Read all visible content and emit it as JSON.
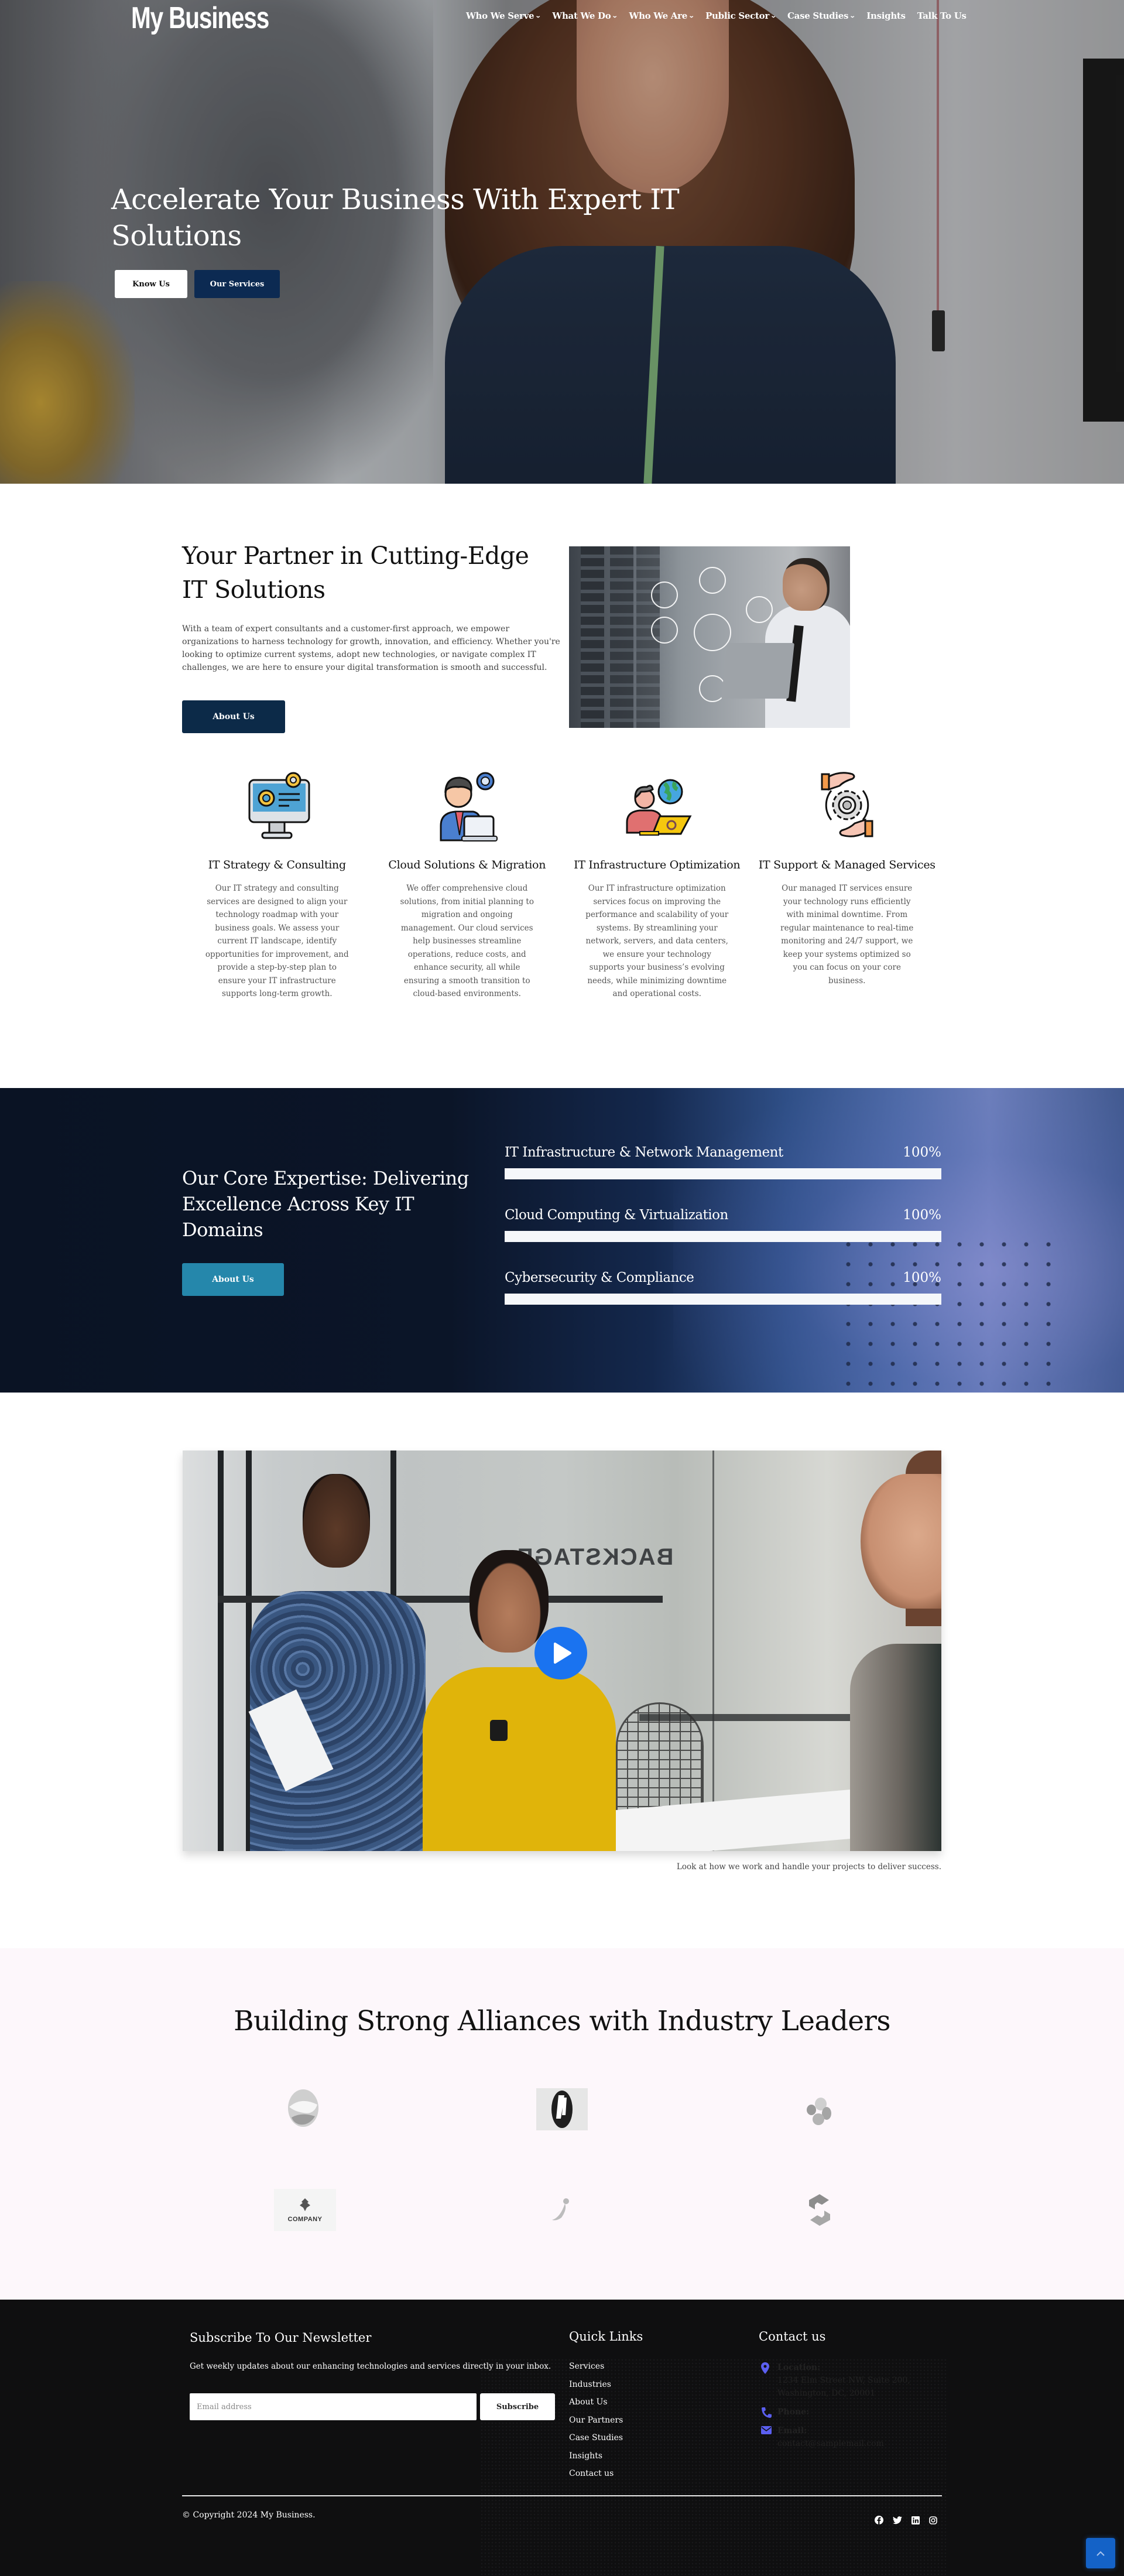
{
  "brand": {
    "name": "My Business"
  },
  "nav": {
    "items": [
      {
        "label": "Who We Serve",
        "dropdown": true
      },
      {
        "label": "What We Do",
        "dropdown": true
      },
      {
        "label": "Who We Are",
        "dropdown": true
      },
      {
        "label": "Public Sector",
        "dropdown": true
      },
      {
        "label": "Case Studies",
        "dropdown": true
      },
      {
        "label": "Insights",
        "dropdown": false
      },
      {
        "label": "Talk To Us",
        "dropdown": false
      }
    ],
    "chevron_icon": "chevron-down-icon"
  },
  "hero": {
    "title": "Accelerate Your Business With Expert IT Solutions",
    "primary_button": "Know Us",
    "secondary_button": "Our Services"
  },
  "about": {
    "title": "Your Partner in Cutting-Edge IT Solutions",
    "text": "With a team of expert consultants and a customer-first approach, we empower organizations to harness technology for growth, innovation, and efficiency. Whether you're looking to optimize current systems, adopt new technologies, or navigate complex IT challenges, we are here to ensure your digital transformation is smooth and successful.",
    "button": "About Us"
  },
  "services": [
    {
      "icon": "monitor-gear-icon",
      "title": "IT Strategy & Consulting",
      "text": "Our IT strategy and consulting services are designed to align your technology roadmap with your business goals. We assess your current IT landscape, identify opportunities for improvement, and provide a step-by-step plan to ensure your IT infrastructure supports long-term growth."
    },
    {
      "icon": "consultant-laptop-icon",
      "title": "Cloud Solutions & Migration",
      "text": "We offer comprehensive cloud solutions, from initial planning to migration and ongoing management. Our cloud services help businesses streamline operations, reduce costs, and enhance security, all while ensuring a smooth transition to cloud-based environments."
    },
    {
      "icon": "user-globe-laptop-icon",
      "title": "IT Infrastructure Optimization",
      "text": "Our IT infrastructure optimization services focus on improving the performance and scalability of your systems. By streamlining your network, servers, and data centers, we ensure your technology supports your business’s evolving needs, while minimizing downtime and operational costs."
    },
    {
      "icon": "hands-gear-icon",
      "title": "IT Support & Managed Services",
      "text": "Our managed IT services ensure your technology runs efficiently with minimal downtime. From regular maintenance to real-time monitoring and 24/7 support, we keep your systems optimized so you can focus on your core business."
    }
  ],
  "expertise": {
    "title": "Our Core Expertise: Delivering Excellence Across Key IT Domains",
    "button": "About Us",
    "skills": [
      {
        "label": "IT Infrastructure & Network Management",
        "percent": 100,
        "percent_label": "100%"
      },
      {
        "label": "Cloud Computing & Virtualization",
        "percent": 100,
        "percent_label": "100%"
      },
      {
        "label": "Cybersecurity & Compliance",
        "percent": 100,
        "percent_label": "100%"
      }
    ]
  },
  "video": {
    "play_icon": "play-icon",
    "sign_text": "BACKSTAGE",
    "caption": "Look at how we work and handle your projects to deliver success."
  },
  "partners": {
    "title": "Building Strong Alliances with Industry Leaders",
    "logos": [
      {
        "name": "swirl-sphere-logo"
      },
      {
        "name": "a-oval-logo"
      },
      {
        "name": "pebbles-logo"
      },
      {
        "name": "tree-company-logo",
        "text": "COMPANY"
      },
      {
        "name": "swoosh-figure-logo"
      },
      {
        "name": "s-hexagon-logo"
      }
    ]
  },
  "footer": {
    "newsletter": {
      "title": "Subscribe To Our Newsletter",
      "text": "Get weekly updates about our enhancing technologies and services directly in your inbox.",
      "placeholder": "Email address",
      "button": "Subscribe"
    },
    "quick_links": {
      "title": "Quick Links",
      "items": [
        "Services",
        "Industries",
        "About Us",
        "Our Partners",
        "Case Studies",
        "Insights",
        "Contact us"
      ]
    },
    "contact": {
      "title": "Contact us",
      "location_label": "Location:",
      "location_line1": "1234 Elm Street NW, Suite 200,",
      "location_line2": "Washington, DC, 20001",
      "phone_label": "Phone:",
      "email_label": "Email:",
      "email": "contact@samplemail.com",
      "accent_color": "#5b5ff0"
    },
    "copyright": "© Copyright 2024 My Business.",
    "socials": [
      "facebook-icon",
      "twitter-icon",
      "linkedin-icon",
      "instagram-icon"
    ],
    "back_to_top_icon": "chevron-up-icon"
  },
  "colors": {
    "navy_button": "#0c2a52",
    "teal_button": "#2587ab",
    "play_blue": "#1a73f0",
    "footer_bg": "#0f0f10",
    "partners_bg": "#fdf7fb",
    "back_to_top": "#1462c7"
  }
}
